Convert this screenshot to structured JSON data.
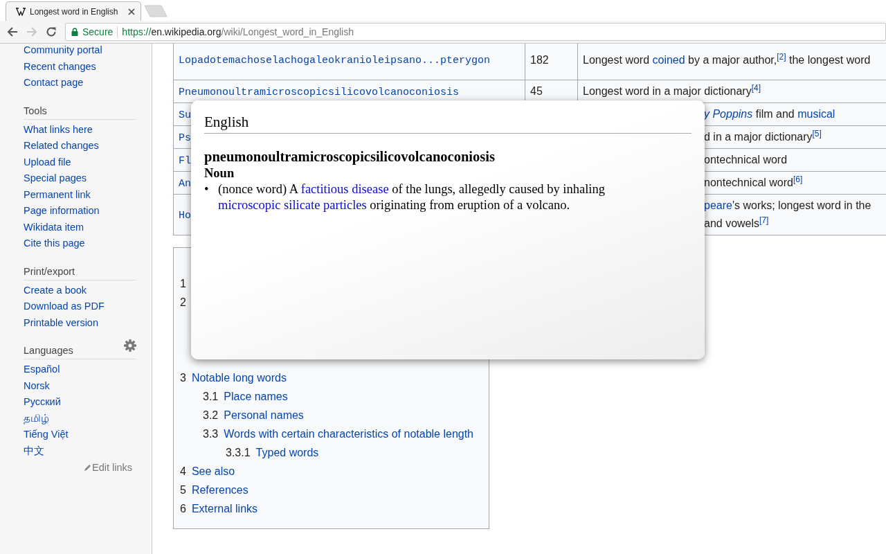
{
  "browser": {
    "tab_title": "Longest word in English",
    "secure_label": "Secure",
    "url_scheme": "https://",
    "url_host": "en.wikipedia.org",
    "url_path": "/wiki/Longest_word_in_English",
    "forward_disabled": true
  },
  "sidebar": {
    "sections": [
      {
        "items": [
          "Community portal",
          "Recent changes",
          "Contact page"
        ]
      },
      {
        "heading": "Tools",
        "items": [
          "What links here",
          "Related changes",
          "Upload file",
          "Special pages",
          "Permanent link",
          "Page information",
          "Wikidata item",
          "Cite this page"
        ]
      },
      {
        "heading": "Print/export",
        "items": [
          "Create a book",
          "Download as PDF",
          "Printable version"
        ]
      },
      {
        "heading": "Languages",
        "settings": true,
        "items": [
          "Español",
          "Norsk",
          "Русский",
          "தமிழ்",
          "Tiếng Việt",
          "中文"
        ],
        "edit_links": "Edit links"
      }
    ]
  },
  "table": {
    "rows": [
      {
        "kind": "full",
        "word": "Lopadotemachoselachogaleokranioleipsano...pterygon",
        "letters": "182",
        "lines": [
          [
            {
              "text": "Longest word "
            },
            {
              "text": "coined",
              "link": true
            },
            {
              "text": " by a major author,"
            },
            {
              "text": "[2]",
              "link": true,
              "sup": true
            },
            {
              "text": " the longest word"
            }
          ]
        ]
      },
      {
        "kind": "full",
        "word": "Pneumonoultramicroscopicsilicovolcanoconiosis",
        "letters": "45",
        "lines": [
          [
            {
              "text": "Longest word in a major dictionary"
            },
            {
              "text": "[4]",
              "link": true,
              "sup": true
            }
          ]
        ]
      },
      {
        "kind": "covered",
        "word": "Su",
        "lines": [
          [
            {
              "text": "y Poppins",
              "link": true,
              "italic": true
            },
            {
              "text": " film and "
            },
            {
              "text": "musical",
              "link": true
            }
          ]
        ]
      },
      {
        "kind": "covered",
        "word": "Ps",
        "lines": [
          [
            {
              "text": "d in a major dictionary"
            },
            {
              "text": "[5]",
              "link": true,
              "sup": true
            }
          ]
        ]
      },
      {
        "kind": "covered",
        "word": "Fl",
        "lines": [
          [
            {
              "text": "ontechnical word"
            }
          ]
        ]
      },
      {
        "kind": "covered",
        "word": "An",
        "lines": [
          [
            {
              "text": " nontechnical word"
            },
            {
              "text": "[6]",
              "link": true,
              "sup": true
            }
          ]
        ]
      },
      {
        "kind": "covered",
        "word": "Ho",
        "lines": [
          [
            {
              "text": "peare",
              "link": true
            },
            {
              "text": "'s works; longest word in the"
            }
          ],
          [
            {
              "text": "and vowels"
            },
            {
              "text": "[7]",
              "link": true,
              "sup": true
            }
          ]
        ]
      }
    ]
  },
  "toc": {
    "entries_above": [
      {
        "number": "1"
      },
      {
        "number": "2"
      }
    ],
    "entries_below": [
      {
        "number": "3",
        "title": "Notable long words",
        "children": [
          {
            "number": "3.1",
            "title": "Place names"
          },
          {
            "number": "3.2",
            "title": "Personal names"
          },
          {
            "number": "3.3",
            "title": "Words with certain characteristics of notable length",
            "children": [
              {
                "number": "3.3.1",
                "title": "Typed words"
              }
            ]
          }
        ]
      },
      {
        "number": "4",
        "title": "See also"
      },
      {
        "number": "5",
        "title": "References"
      },
      {
        "number": "6",
        "title": "External links"
      }
    ]
  },
  "popup": {
    "language": "English",
    "headword": "pneumonoultramicroscopicsilicovolcanoconiosis",
    "part_of_speech": "Noun",
    "definitions": [
      {
        "marker": "•",
        "lines": [
          [
            {
              "text": "(nonce word) A "
            },
            {
              "text": "factitious disease",
              "link": true
            },
            {
              "text": " of the lungs, allegedly caused by inhaling"
            }
          ],
          [
            {
              "text": "microscopic silicate particles",
              "link": true
            },
            {
              "text": " originating from eruption of a volcano."
            }
          ]
        ]
      }
    ]
  }
}
